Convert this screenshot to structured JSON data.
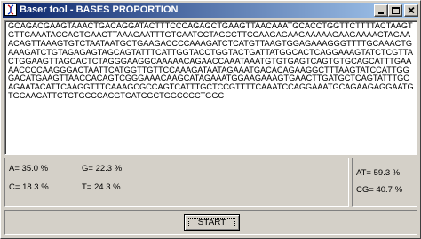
{
  "window": {
    "title": "Baser tool - BASES PROPORTION",
    "icon": "dna-app-icon",
    "controls": [
      "minimize-icon",
      "maximize-icon",
      "close-icon"
    ]
  },
  "sequence": "GCAGACGAAGTAAACTGACAGGATACTTTCCCAGAGCTGAAGTTAACAAATGCACCTGGTTCTTTTACTAAGTGTTCAAATACCAGTGAACTTAAAGAATTTGTCAATCCTAGCCTTCCAAGAGAAGAAAAAGAAGAAAACTAGAAACAGTTAAAGTGTCTAATAATGCTGAAGACCCCAAAGATCTCATGTTAAGTGGAGAAAGGGTTTTGCAAACTGAAAGATCTGTAGAGAGTAGCAGTATTTCATTGGTACCTGGTACTGATTATGGCACTCAGGAAAGTATCTCGTTACTGGAAGTTAGCACTCTAGGGAAGGCAAAAACAGAACCAAATAAATGTGTGAGTCAGTGTGCAGCATTTGAAAACCCCAAGGGACTAATTCATGGTTGTTCCAAAGATAATAGAAATGACACAGAAGGCTTTAAGTATCCATTGGGACATGAAGTTAACCACAGTCGGGAAACAAGCATAGAAATGGAAGAAAGTGAACTTGATGCTCAGTATTTGCAGAATACATTCAAGGTTTCAAAGCGCCAGTCATTTGCTCCGTTTTCAAATCCAGGAAATGCAGAAGAGGAATGTGCAACATTCTCTGCCCACGTCATCGCTGGCCCCTGGC",
  "bases": {
    "a_label": "A=",
    "a_value": "35.0 %",
    "g_label": "G=",
    "g_value": "22.3 %",
    "c_label": "C=",
    "c_value": "18.3 %",
    "t_label": "T=",
    "t_value": "24.3 %"
  },
  "content": {
    "at_label": "AT=",
    "at_value": "59.3 %",
    "cg_label": "CG=",
    "cg_value": "40.7 %"
  },
  "actions": {
    "start_label": "START"
  }
}
